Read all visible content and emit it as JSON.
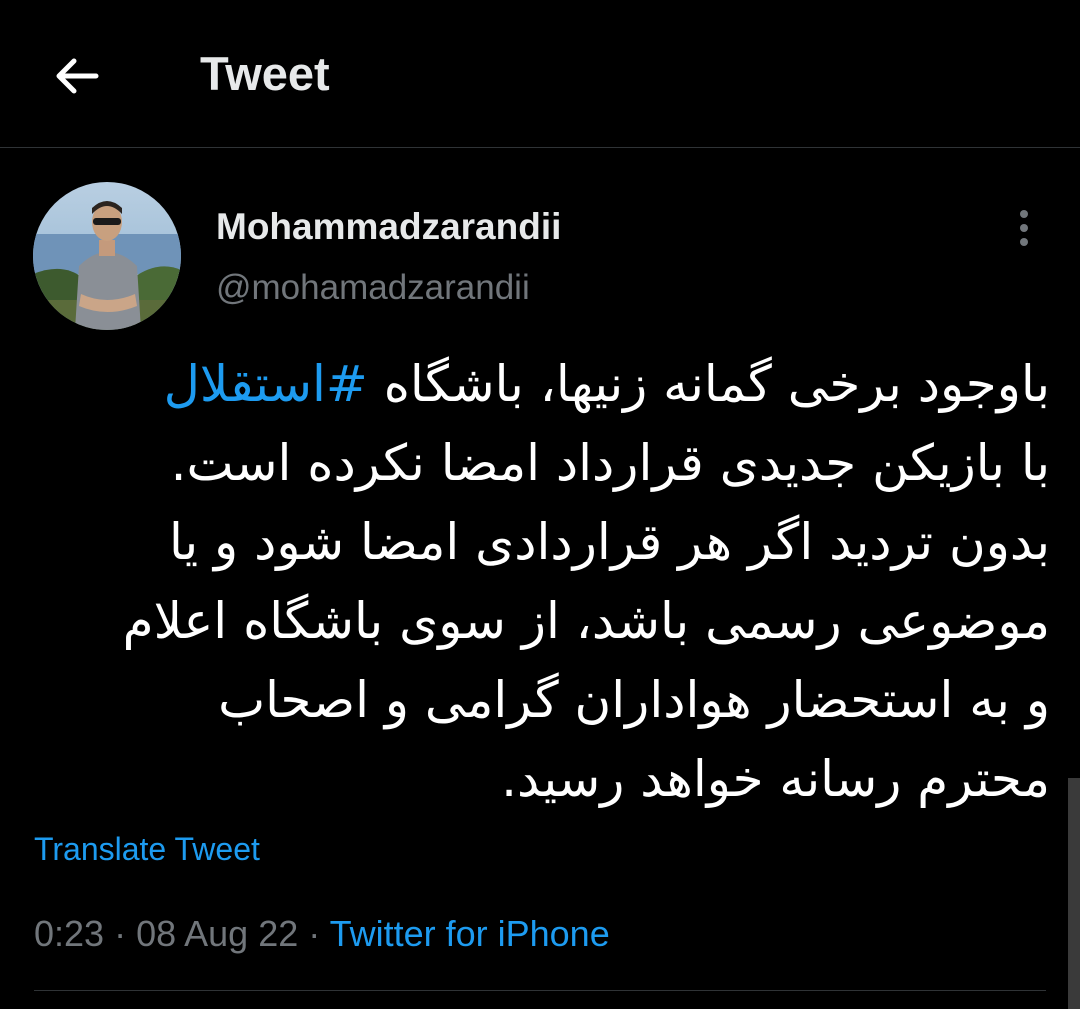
{
  "header": {
    "title": "Tweet",
    "back_icon": "arrow-left-icon"
  },
  "tweet": {
    "author": {
      "display_name": "Mohammadzarandii",
      "handle": "@mohamadzarandii"
    },
    "more_icon": "more-vertical-icon",
    "text": {
      "line1_before": "باوجود برخی گمانه زنیها، باشگاه ",
      "hashtag": "#استقلال",
      "line2": "با بازیکن جدیدی قرارداد امضا نکرده است.",
      "line3": "بدون تردید اگر هر قراردادی امضا شود و یا",
      "line4": "موضوعی رسمی باشد، از سوی باشگاه اعلام",
      "line5": "و به استحضار هواداران گرامی و اصحاب",
      "line6": "محترم رسانه خواهد رسید."
    },
    "translate_label": "Translate Tweet",
    "meta": {
      "time": "0:23",
      "separator": " · ",
      "date": "08 Aug 22",
      "source": "Twitter for iPhone"
    }
  },
  "colors": {
    "background": "#000000",
    "text": "#e7e9ea",
    "secondary": "#71767b",
    "accent": "#1d9bf0",
    "divider": "#2f3336"
  }
}
